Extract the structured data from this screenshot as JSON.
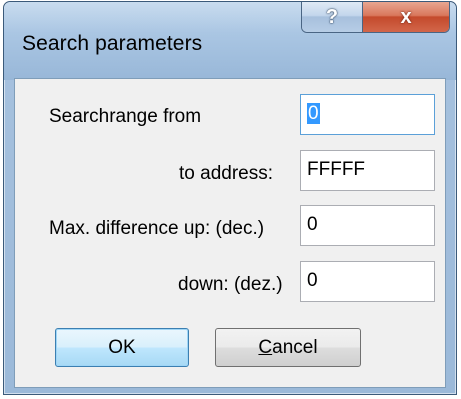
{
  "window": {
    "title": "Search parameters",
    "help_glyph": "?",
    "close_glyph": "x"
  },
  "form": {
    "searchrange_label": "Searchrange from",
    "searchrange_value": "0",
    "to_address_label": "to address:",
    "to_address_value": "FFFFF",
    "max_diff_up_label": "Max. difference up: (dec.)",
    "max_diff_up_value": "0",
    "down_label": "down: (dez.)",
    "down_value": "0"
  },
  "buttons": {
    "ok_label": "OK",
    "cancel_first": "C",
    "cancel_rest": "ancel"
  },
  "colors": {
    "accent": "#3399ff",
    "close_button": "#c44a2c"
  }
}
